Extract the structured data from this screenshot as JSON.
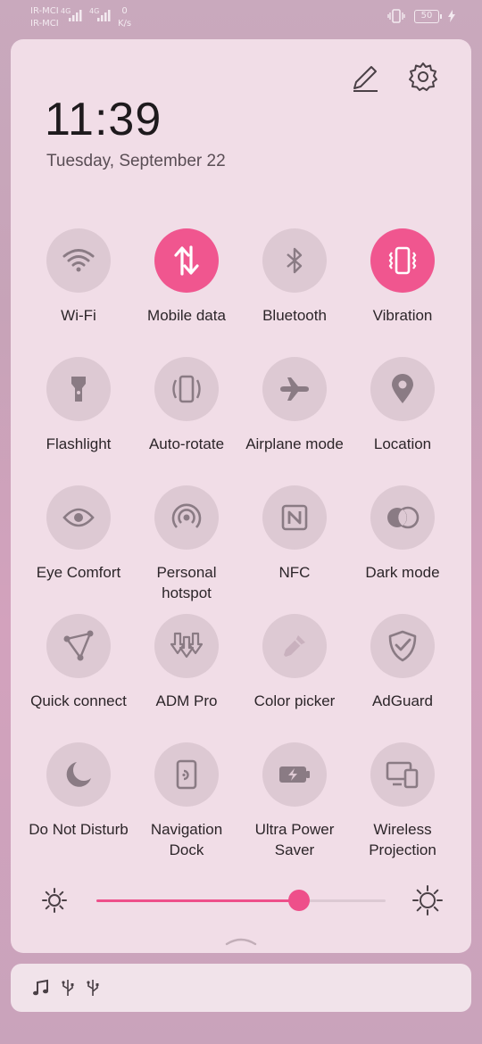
{
  "status": {
    "carrier1": "IR-MCI",
    "carrier2": "IR-MCI",
    "net1": "4G",
    "net2": "4G",
    "speed_value": "0",
    "speed_unit": "K/s",
    "battery": "50"
  },
  "header": {
    "time": "11:39",
    "date": "Tuesday, September 22"
  },
  "tiles": [
    {
      "label": "Wi-Fi",
      "icon": "wifi-icon",
      "on": false
    },
    {
      "label": "Mobile data",
      "icon": "mobile-data-icon",
      "on": true
    },
    {
      "label": "Bluetooth",
      "icon": "bluetooth-icon",
      "on": false
    },
    {
      "label": "Vibration",
      "icon": "vibration-icon",
      "on": true
    },
    {
      "label": "Flashlight",
      "icon": "flashlight-icon",
      "on": false
    },
    {
      "label": "Auto-rotate",
      "icon": "auto-rotate-icon",
      "on": false
    },
    {
      "label": "Airplane mode",
      "icon": "airplane-icon",
      "on": false
    },
    {
      "label": "Location",
      "icon": "location-icon",
      "on": false
    },
    {
      "label": "Eye Comfort",
      "icon": "eye-icon",
      "on": false
    },
    {
      "label": "Personal hotspot",
      "icon": "hotspot-icon",
      "on": false
    },
    {
      "label": "NFC",
      "icon": "nfc-icon",
      "on": false
    },
    {
      "label": "Dark mode",
      "icon": "dark-mode-icon",
      "on": false
    },
    {
      "label": "Quick connect",
      "icon": "quick-connect-icon",
      "on": false
    },
    {
      "label": "ADM Pro",
      "icon": "adm-pro-icon",
      "on": false
    },
    {
      "label": "Color picker",
      "icon": "color-picker-icon",
      "on": false
    },
    {
      "label": "AdGuard",
      "icon": "adguard-icon",
      "on": false
    },
    {
      "label": "Do Not Disturb",
      "icon": "moon-icon",
      "on": false
    },
    {
      "label": "Navigation Dock",
      "icon": "navigation-dock-icon",
      "on": false
    },
    {
      "label": "Ultra Power Saver",
      "icon": "battery-saver-icon",
      "on": false
    },
    {
      "label": "Wireless Projection",
      "icon": "projection-icon",
      "on": false
    }
  ],
  "brightness": {
    "level": 0.7
  },
  "colors": {
    "accent": "#f0568f",
    "tile_off": "#ddc9d3",
    "panel": "#f1dde7"
  },
  "notification_icons": [
    "music-note-icon",
    "usb-icon",
    "usb-icon"
  ]
}
